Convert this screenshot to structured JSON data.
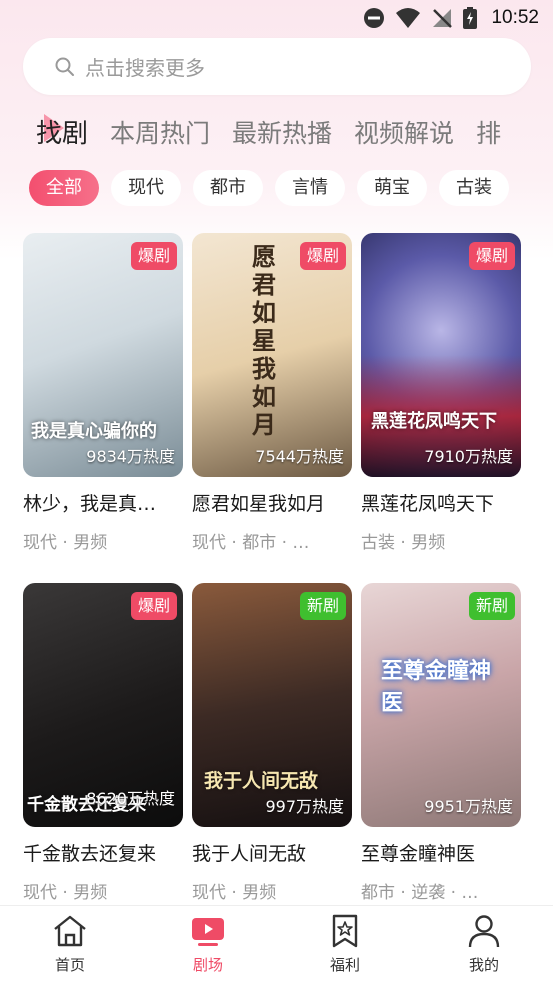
{
  "status_bar": {
    "time": "10:52"
  },
  "search": {
    "placeholder": "点击搜索更多"
  },
  "tabs": [
    {
      "label": "找剧",
      "active": true
    },
    {
      "label": "本周热门"
    },
    {
      "label": "最新热播"
    },
    {
      "label": "视频解说"
    },
    {
      "label": "排"
    }
  ],
  "chips": [
    {
      "label": "全部",
      "active": true
    },
    {
      "label": "现代"
    },
    {
      "label": "都市"
    },
    {
      "label": "言情"
    },
    {
      "label": "萌宝"
    },
    {
      "label": "古装"
    }
  ],
  "cards": [
    {
      "title": "林少，我是真…",
      "tags": "现代 · 男频",
      "badge": "爆剧",
      "heat": "9834万热度",
      "art": "我是真心骗你的"
    },
    {
      "title": "愿君如星我如月",
      "tags": "现代 · 都市 · …",
      "badge": "爆剧",
      "heat": "7544万热度",
      "art": "愿君如星我如月"
    },
    {
      "title": "黑莲花凤鸣天下",
      "tags": "古装 · 男频",
      "badge": "爆剧",
      "heat": "7910万热度",
      "art": "黑莲花凤鸣天下"
    },
    {
      "title": "千金散去还复来",
      "tags": "现代 · 男频",
      "badge": "爆剧",
      "heat": "8620万热度",
      "art": "千金散去还复来"
    },
    {
      "title": "我于人间无敌",
      "tags": "现代 · 男频",
      "badge": "新剧",
      "heat": "997万热度",
      "art": "我于人间无敌"
    },
    {
      "title": "至尊金瞳神医",
      "tags": "都市 · 逆袭 · …",
      "badge": "新剧",
      "heat": "9951万热度",
      "art": "至尊金瞳神医"
    }
  ],
  "bottom_nav": [
    {
      "label": "首页",
      "icon": "home-icon"
    },
    {
      "label": "剧场",
      "icon": "theater-icon",
      "active": true
    },
    {
      "label": "福利",
      "icon": "bookmark-star-icon"
    },
    {
      "label": "我的",
      "icon": "person-icon"
    }
  ],
  "colors": {
    "accent": "#ef4b66",
    "new_badge": "#3fbf2f"
  }
}
